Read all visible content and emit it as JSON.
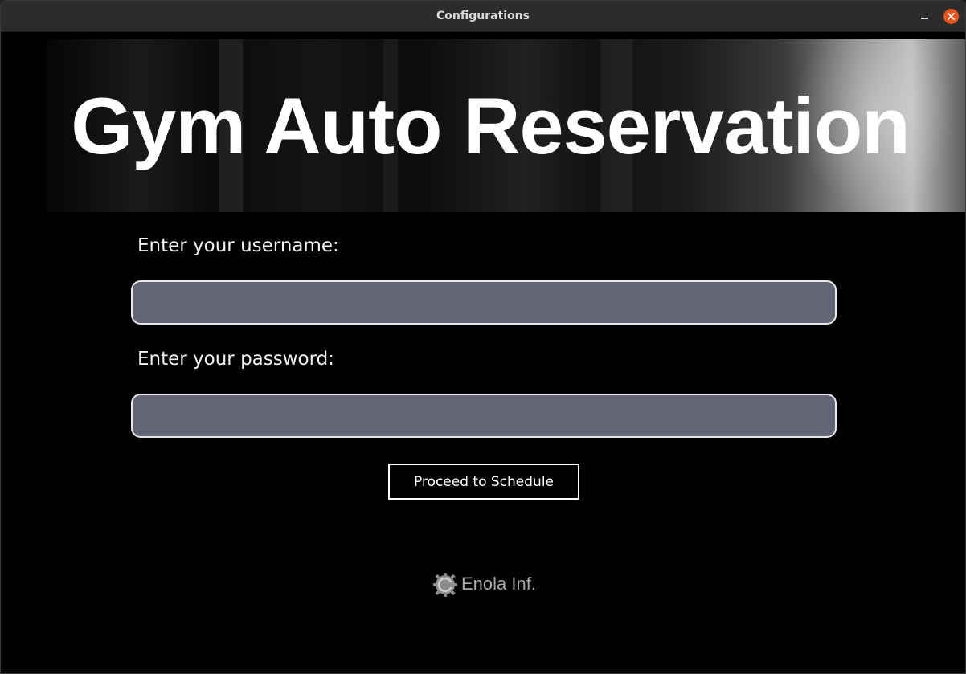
{
  "window": {
    "title": "Configurations",
    "minimize_icon": "minimize-icon",
    "close_icon": "close-icon",
    "close_color": "#e95420"
  },
  "banner": {
    "title": "Gym Auto Reservation"
  },
  "form": {
    "username_label": "Enter your username:",
    "username_value": "",
    "password_label": "Enter your password:",
    "password_value": "",
    "field_color": "#646678",
    "proceed_label": "Proceed to Schedule"
  },
  "footer": {
    "brand": "Enola Inf.",
    "logo_icon": "gear-logo-icon"
  }
}
